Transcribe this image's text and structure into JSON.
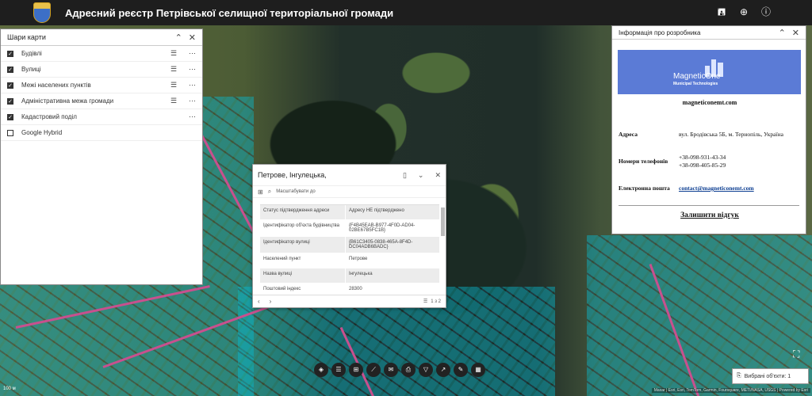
{
  "header": {
    "title": "Адресний реєстр Петрівської селищної територіальної громади",
    "icons": [
      "save-icon",
      "globe-icon",
      "info-icon"
    ]
  },
  "layers_panel": {
    "title": "Шари карти",
    "items": [
      {
        "label": "Будівлі",
        "checked": true
      },
      {
        "label": "Вулиці",
        "checked": true
      },
      {
        "label": "Межі населених пунктів",
        "checked": true
      },
      {
        "label": "Адміністративна межа громади",
        "checked": true
      },
      {
        "label": "Кадастровий поділ",
        "checked": true
      },
      {
        "label": "Google Hybrid",
        "checked": false
      }
    ]
  },
  "info_panel": {
    "title": "Інформація про розробника",
    "brand_name": "MagneticOne",
    "brand_sub": "Municipal Technologies",
    "site": "magneticonemt.com",
    "address_label": "Адреса",
    "address_value": "вул. Бродівська 5Б, м. Тернопіль, Україна",
    "phones_label": "Номери телефонів",
    "phone1": "+38-098-931-43-34",
    "phone2": "+38-098-405-85-29",
    "email_label": "Електронна пошта",
    "email": "contact@magneticonemt.com",
    "feedback": "Залишити відгук"
  },
  "popup": {
    "title": "Петрове, Інгулецька,",
    "zoom_label": "Масштабувати до",
    "rows": [
      {
        "k": "Статус підтвердження адреси",
        "v": "Адресу НЕ підтверджено"
      },
      {
        "k": "Ідентифікатор об'єкта будівництва",
        "v": "{F4B45EAB-B977-4F0D-AD04-02BE67B5FC1B}"
      },
      {
        "k": "Ідентифікатор вулиці",
        "v": "{B61C3405-0838-465A-8F4D-DC04ADB6BADC}"
      },
      {
        "k": "Населений пункт",
        "v": "Петрове"
      },
      {
        "k": "Назва вулиці",
        "v": "Інгулецька"
      },
      {
        "k": "Поштовий індекс",
        "v": "28300"
      }
    ],
    "pager": "1 з 2"
  },
  "selected_label": "Вибрані об'єкти: 1",
  "scale_label": "100 м",
  "attribution": "Maxar | Esri, Esri, TomTom, Garmin, Foursquare, METI/NASA, USGS | Powered by Esri"
}
